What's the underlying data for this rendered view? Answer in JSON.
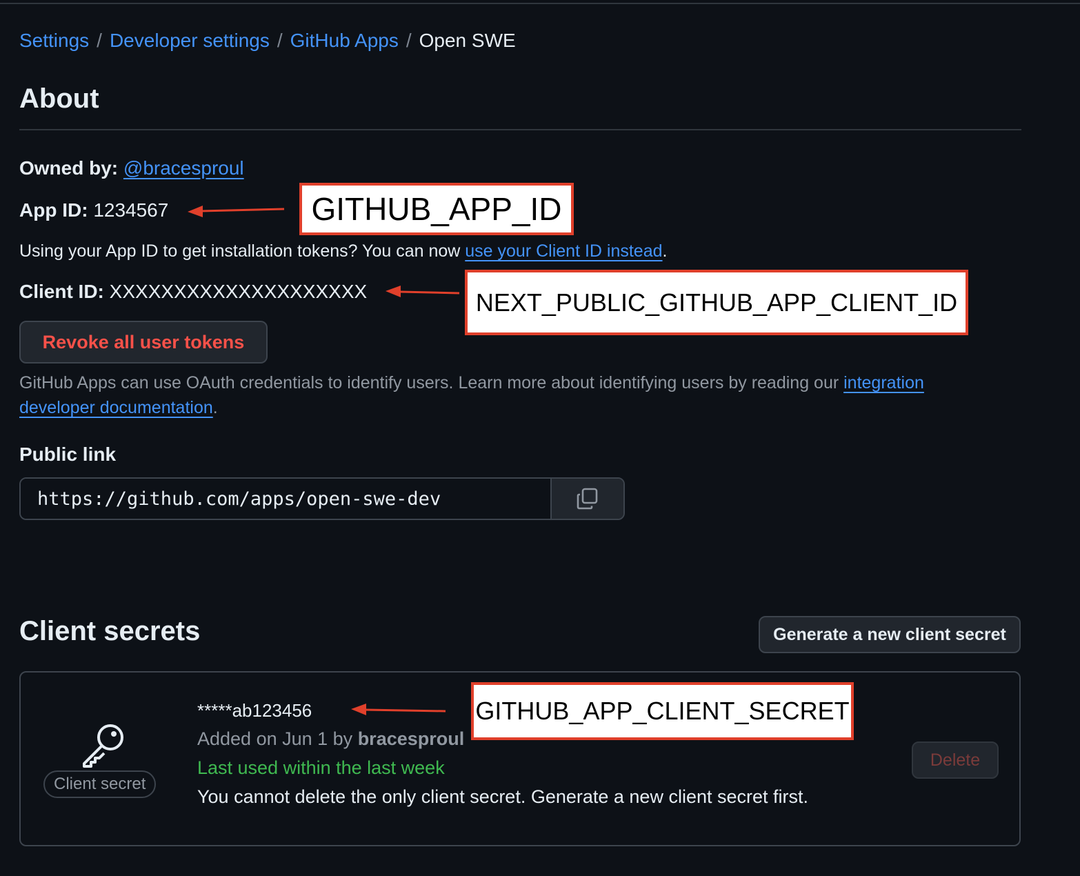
{
  "breadcrumb": {
    "items": [
      "Settings",
      "Developer settings",
      "GitHub Apps"
    ],
    "separator": "/",
    "current": "Open SWE"
  },
  "about": {
    "title": "About",
    "owned_by_label": "Owned by:",
    "owned_by_value": "@bracesproul",
    "app_id_label": "App ID:",
    "app_id_value": "1234567",
    "using_text": "Using your App ID to get installation tokens? You can now ",
    "using_link": "use your Client ID instead",
    "using_end": ".",
    "client_id_label": "Client ID:",
    "client_id_value": "XXXXXXXXXXXXXXXXXXXX",
    "revoke_button": "Revoke all user tokens",
    "oauth_text": "GitHub Apps can use OAuth credentials to identify users. Learn more about identifying users by reading our ",
    "oauth_link": "integration developer documentation",
    "oauth_end": "."
  },
  "public_link": {
    "label": "Public link",
    "url": "https://github.com/apps/open-swe-dev",
    "copy_icon": "copy-icon"
  },
  "client_secrets": {
    "title": "Client secrets",
    "generate_button": "Generate a new client secret",
    "secret": {
      "icon": "key-icon",
      "badge": "Client secret",
      "value": "*****ab123456",
      "added_prefix": "Added on Jun 1 by ",
      "added_by": "bracesproul",
      "last_used": "Last used within the last week",
      "note": "You cannot delete the only client secret. Generate a new client secret first.",
      "delete_button": "Delete"
    }
  },
  "annotations": {
    "app_id": "GITHUB_APP_ID",
    "client_id": "NEXT_PUBLIC_GITHUB_APP_CLIENT_ID",
    "client_secret": "GITHUB_APP_CLIENT_SECRET",
    "color": "#e0402b"
  },
  "colors": {
    "background": "#0d1117",
    "link": "#4493f8",
    "danger": "#f85149",
    "success": "#3fb950",
    "border": "#3d444d"
  }
}
